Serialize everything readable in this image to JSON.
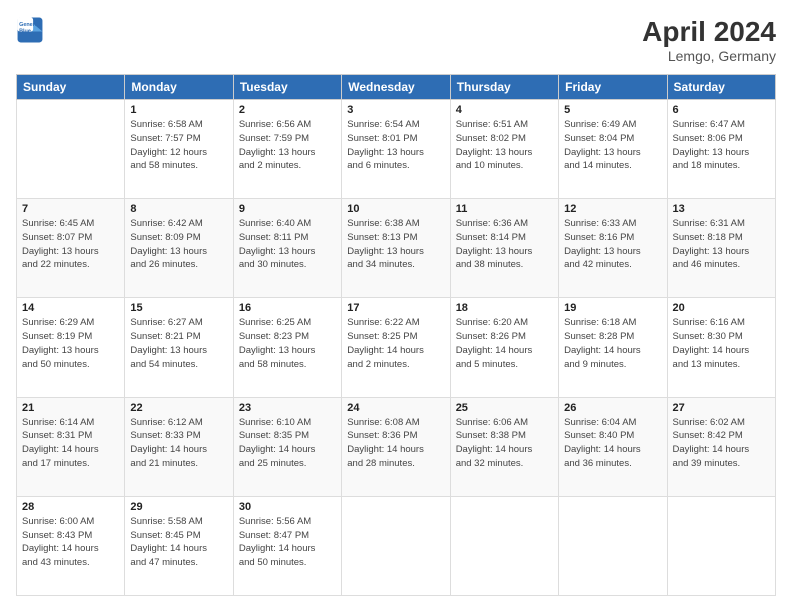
{
  "header": {
    "logo_line1": "General",
    "logo_line2": "Blue",
    "month_title": "April 2024",
    "location": "Lemgo, Germany"
  },
  "weekdays": [
    "Sunday",
    "Monday",
    "Tuesday",
    "Wednesday",
    "Thursday",
    "Friday",
    "Saturday"
  ],
  "weeks": [
    [
      {
        "day": "",
        "info": ""
      },
      {
        "day": "1",
        "info": "Sunrise: 6:58 AM\nSunset: 7:57 PM\nDaylight: 12 hours\nand 58 minutes."
      },
      {
        "day": "2",
        "info": "Sunrise: 6:56 AM\nSunset: 7:59 PM\nDaylight: 13 hours\nand 2 minutes."
      },
      {
        "day": "3",
        "info": "Sunrise: 6:54 AM\nSunset: 8:01 PM\nDaylight: 13 hours\nand 6 minutes."
      },
      {
        "day": "4",
        "info": "Sunrise: 6:51 AM\nSunset: 8:02 PM\nDaylight: 13 hours\nand 10 minutes."
      },
      {
        "day": "5",
        "info": "Sunrise: 6:49 AM\nSunset: 8:04 PM\nDaylight: 13 hours\nand 14 minutes."
      },
      {
        "day": "6",
        "info": "Sunrise: 6:47 AM\nSunset: 8:06 PM\nDaylight: 13 hours\nand 18 minutes."
      }
    ],
    [
      {
        "day": "7",
        "info": "Sunrise: 6:45 AM\nSunset: 8:07 PM\nDaylight: 13 hours\nand 22 minutes."
      },
      {
        "day": "8",
        "info": "Sunrise: 6:42 AM\nSunset: 8:09 PM\nDaylight: 13 hours\nand 26 minutes."
      },
      {
        "day": "9",
        "info": "Sunrise: 6:40 AM\nSunset: 8:11 PM\nDaylight: 13 hours\nand 30 minutes."
      },
      {
        "day": "10",
        "info": "Sunrise: 6:38 AM\nSunset: 8:13 PM\nDaylight: 13 hours\nand 34 minutes."
      },
      {
        "day": "11",
        "info": "Sunrise: 6:36 AM\nSunset: 8:14 PM\nDaylight: 13 hours\nand 38 minutes."
      },
      {
        "day": "12",
        "info": "Sunrise: 6:33 AM\nSunset: 8:16 PM\nDaylight: 13 hours\nand 42 minutes."
      },
      {
        "day": "13",
        "info": "Sunrise: 6:31 AM\nSunset: 8:18 PM\nDaylight: 13 hours\nand 46 minutes."
      }
    ],
    [
      {
        "day": "14",
        "info": "Sunrise: 6:29 AM\nSunset: 8:19 PM\nDaylight: 13 hours\nand 50 minutes."
      },
      {
        "day": "15",
        "info": "Sunrise: 6:27 AM\nSunset: 8:21 PM\nDaylight: 13 hours\nand 54 minutes."
      },
      {
        "day": "16",
        "info": "Sunrise: 6:25 AM\nSunset: 8:23 PM\nDaylight: 13 hours\nand 58 minutes."
      },
      {
        "day": "17",
        "info": "Sunrise: 6:22 AM\nSunset: 8:25 PM\nDaylight: 14 hours\nand 2 minutes."
      },
      {
        "day": "18",
        "info": "Sunrise: 6:20 AM\nSunset: 8:26 PM\nDaylight: 14 hours\nand 5 minutes."
      },
      {
        "day": "19",
        "info": "Sunrise: 6:18 AM\nSunset: 8:28 PM\nDaylight: 14 hours\nand 9 minutes."
      },
      {
        "day": "20",
        "info": "Sunrise: 6:16 AM\nSunset: 8:30 PM\nDaylight: 14 hours\nand 13 minutes."
      }
    ],
    [
      {
        "day": "21",
        "info": "Sunrise: 6:14 AM\nSunset: 8:31 PM\nDaylight: 14 hours\nand 17 minutes."
      },
      {
        "day": "22",
        "info": "Sunrise: 6:12 AM\nSunset: 8:33 PM\nDaylight: 14 hours\nand 21 minutes."
      },
      {
        "day": "23",
        "info": "Sunrise: 6:10 AM\nSunset: 8:35 PM\nDaylight: 14 hours\nand 25 minutes."
      },
      {
        "day": "24",
        "info": "Sunrise: 6:08 AM\nSunset: 8:36 PM\nDaylight: 14 hours\nand 28 minutes."
      },
      {
        "day": "25",
        "info": "Sunrise: 6:06 AM\nSunset: 8:38 PM\nDaylight: 14 hours\nand 32 minutes."
      },
      {
        "day": "26",
        "info": "Sunrise: 6:04 AM\nSunset: 8:40 PM\nDaylight: 14 hours\nand 36 minutes."
      },
      {
        "day": "27",
        "info": "Sunrise: 6:02 AM\nSunset: 8:42 PM\nDaylight: 14 hours\nand 39 minutes."
      }
    ],
    [
      {
        "day": "28",
        "info": "Sunrise: 6:00 AM\nSunset: 8:43 PM\nDaylight: 14 hours\nand 43 minutes."
      },
      {
        "day": "29",
        "info": "Sunrise: 5:58 AM\nSunset: 8:45 PM\nDaylight: 14 hours\nand 47 minutes."
      },
      {
        "day": "30",
        "info": "Sunrise: 5:56 AM\nSunset: 8:47 PM\nDaylight: 14 hours\nand 50 minutes."
      },
      {
        "day": "",
        "info": ""
      },
      {
        "day": "",
        "info": ""
      },
      {
        "day": "",
        "info": ""
      },
      {
        "day": "",
        "info": ""
      }
    ]
  ]
}
